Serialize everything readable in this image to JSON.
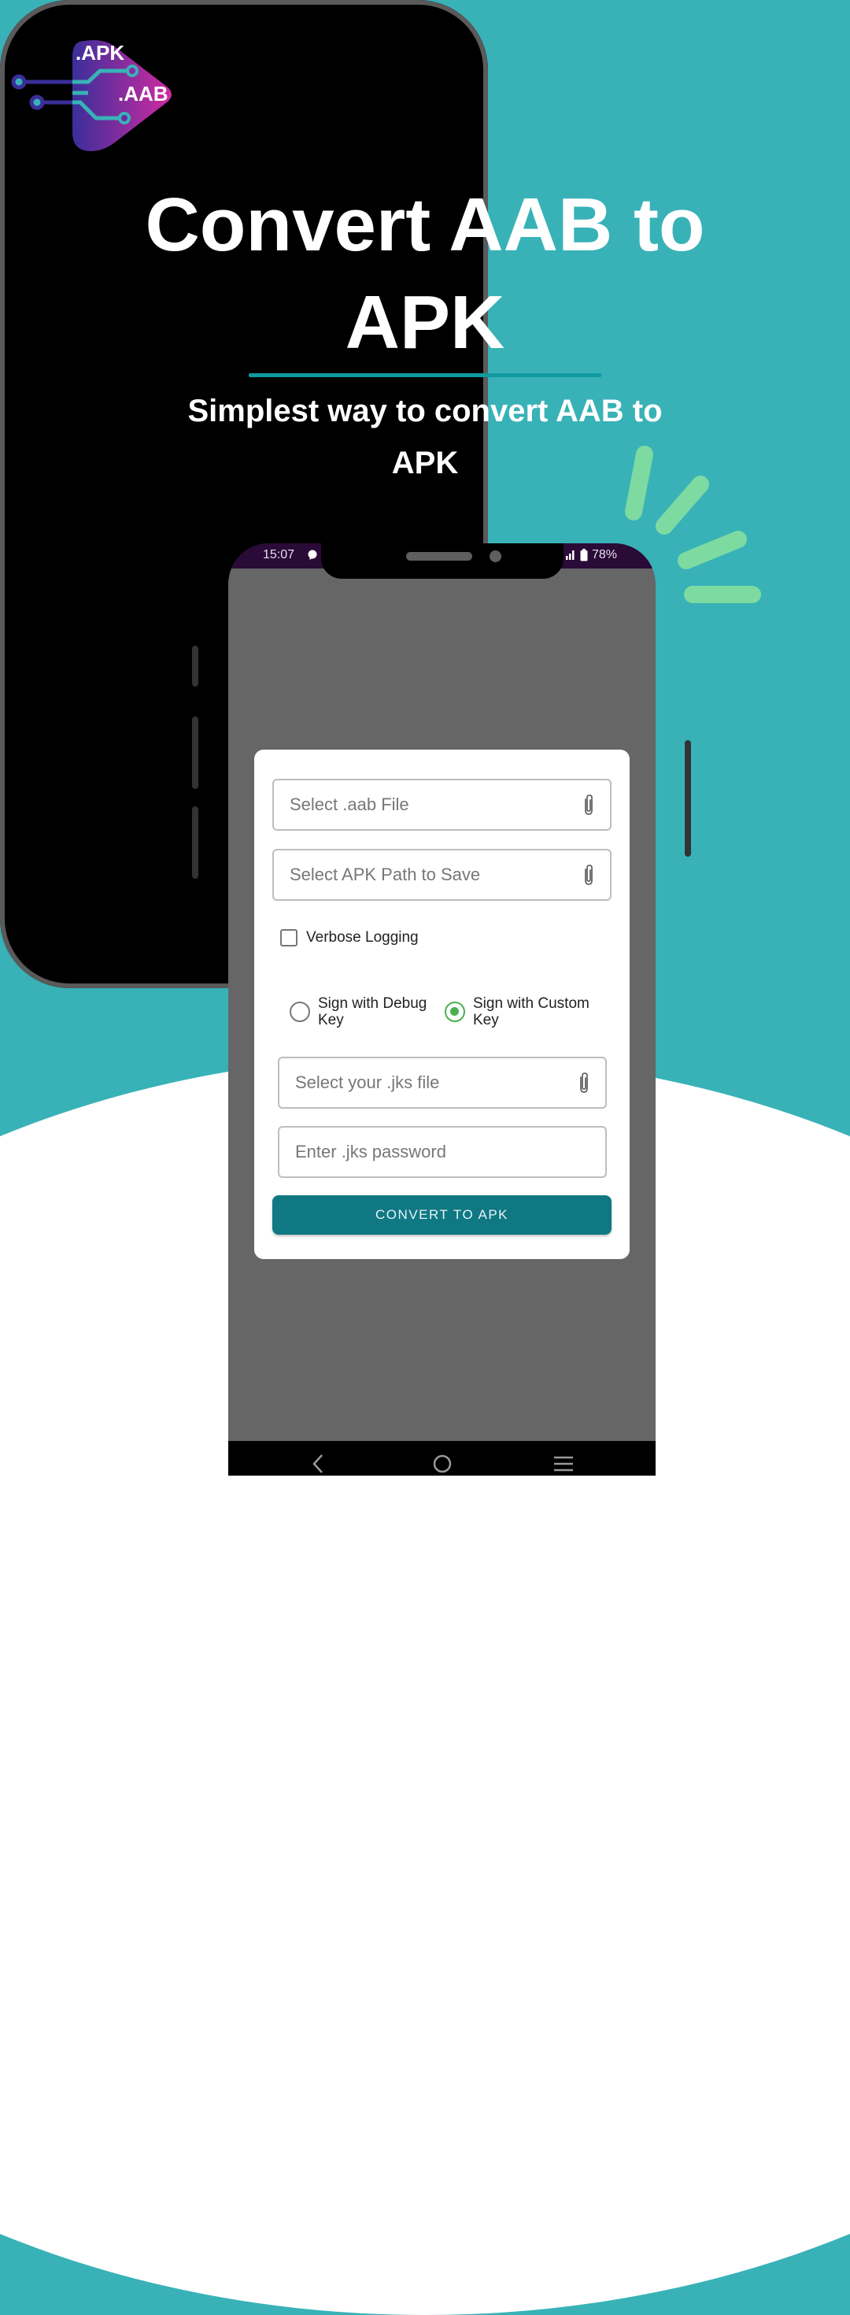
{
  "logo": {
    "apk_label": ".APK",
    "aab_label": ".AAB"
  },
  "headline": {
    "line1": "Convert AAB to",
    "line2": "APK"
  },
  "subtitle": {
    "line1": "Simplest way to convert AAB to",
    "line2": "APK"
  },
  "colors": {
    "background": "#38b2b7",
    "accent": "#0f7883",
    "ray": "#7ddba2",
    "radio_selected": "#4caf50",
    "status_bar": "#2a0a36"
  },
  "status_bar": {
    "time": "15:07",
    "battery": "78%"
  },
  "form": {
    "aab_field": {
      "placeholder": "Select .aab File",
      "value": ""
    },
    "apk_path_field": {
      "placeholder": "Select APK Path to Save",
      "value": ""
    },
    "verbose_logging": {
      "label": "Verbose Logging",
      "checked": false
    },
    "signing": {
      "options": [
        {
          "label": "Sign with Debug Key",
          "selected": false
        },
        {
          "label": "Sign with Custom Key",
          "selected": true
        }
      ]
    },
    "jks_field": {
      "placeholder": "Select your .jks file",
      "value": ""
    },
    "password_field": {
      "placeholder": "Enter .jks password",
      "value": ""
    },
    "convert_button": "CONVERT TO APK"
  },
  "navbar": {
    "back": "back-icon",
    "home": "home-icon",
    "recents": "recents-icon"
  }
}
